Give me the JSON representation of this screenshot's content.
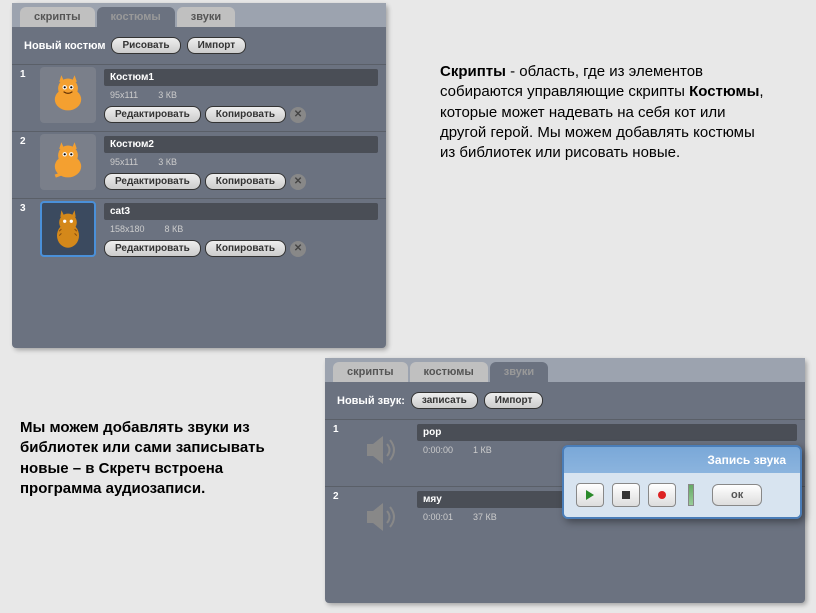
{
  "costumes_panel": {
    "tabs": {
      "scripts": "скрипты",
      "costumes": "костюмы",
      "sounds": "звуки"
    },
    "toolbar_label": "Новый костюм",
    "draw_btn": "Рисовать",
    "import_btn": "Импорт",
    "items": [
      {
        "num": "1",
        "name": "Костюм1",
        "dim": "95x111",
        "size": "3 КВ",
        "edit": "Редактировать",
        "copy": "Копировать"
      },
      {
        "num": "2",
        "name": "Костюм2",
        "dim": "95x111",
        "size": "3 КВ",
        "edit": "Редактировать",
        "copy": "Копировать"
      },
      {
        "num": "3",
        "name": "cat3",
        "dim": "158x180",
        "size": "8 КВ",
        "edit": "Редактировать",
        "copy": "Копировать"
      }
    ]
  },
  "sounds_panel": {
    "tabs": {
      "scripts": "скрипты",
      "costumes": "костюмы",
      "sounds": "звуки"
    },
    "toolbar_label": "Новый звук:",
    "record_btn": "записать",
    "import_btn": "Импорт",
    "items": [
      {
        "num": "1",
        "name": "pop",
        "time": "0:00:00",
        "size": "1 КВ"
      },
      {
        "num": "2",
        "name": "мяу",
        "time": "0:00:01",
        "size": "37 КВ"
      }
    ]
  },
  "recorder": {
    "title": "Запись звука",
    "ok": "ок"
  },
  "text_top": {
    "b1": "Скрипты",
    "t1": " - область, где из элементов собираются управляющие скрипты ",
    "b2": "Костюмы",
    "t2": ", которые может надевать на себя кот или другой герой. Мы можем добавлять костюмы из библиотек или рисовать новые."
  },
  "text_bottom": "Мы можем добавлять звуки из библиотек или сами записывать новые – в Скретч встроена программа аудиозаписи."
}
